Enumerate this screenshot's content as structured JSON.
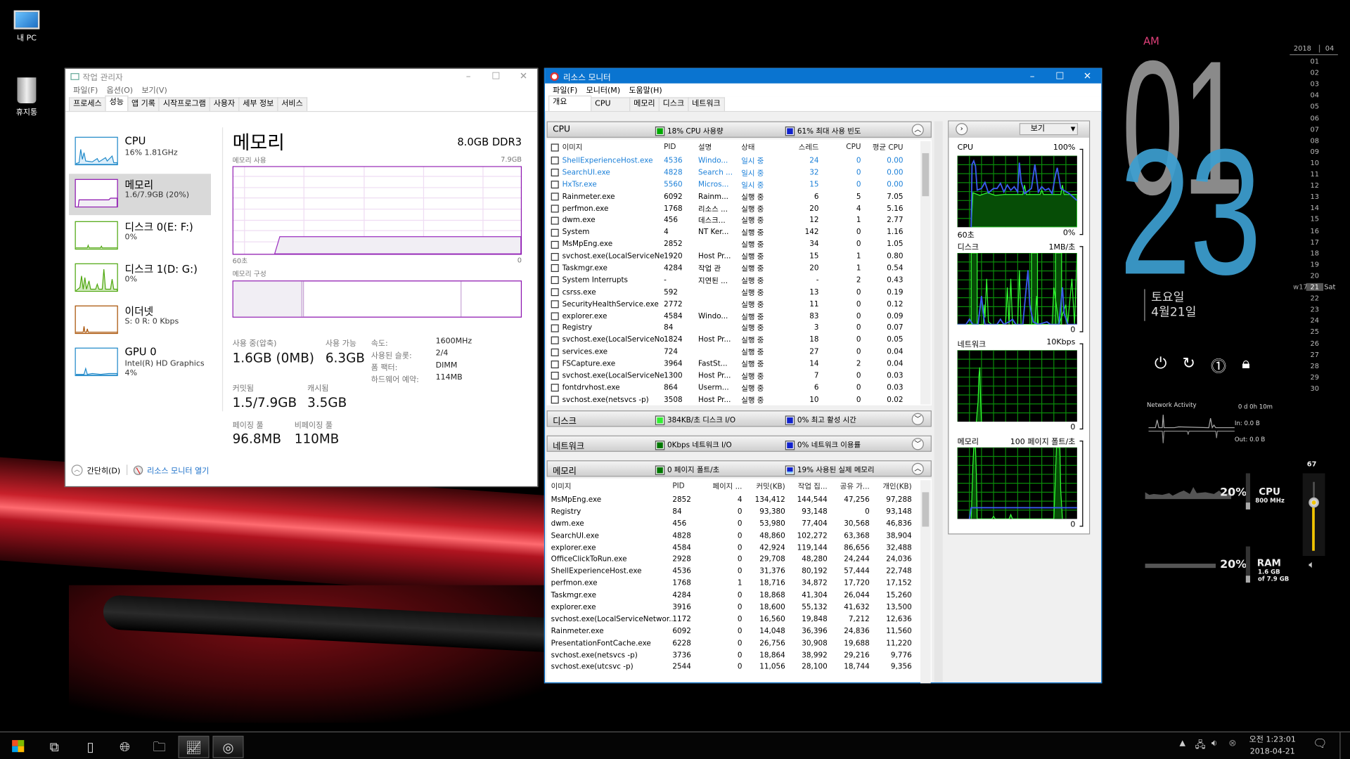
{
  "desktop": {
    "icons": [
      {
        "label": "내 PC",
        "icon": "computer-icon"
      },
      {
        "label": "휴지통",
        "icon": "recycle-bin-icon"
      }
    ]
  },
  "taskmgr": {
    "title": "작업 관리자",
    "menu": [
      "파일(F)",
      "옵션(O)",
      "보기(V)"
    ],
    "tabs": [
      "프로세스",
      "성능",
      "앱 기록",
      "시작프로그램",
      "사용자",
      "세부 정보",
      "서비스"
    ],
    "selected_tab": "성능",
    "sidebar": [
      {
        "title": "CPU",
        "sub": "16% 1.81GHz",
        "color": "#1e88c8"
      },
      {
        "title": "메모리",
        "sub": "1.6/7.9GB (20%)",
        "color": "#8b12ae",
        "selected": true
      },
      {
        "title": "디스크 0(E: F:)",
        "sub": "0%",
        "color": "#4da60c"
      },
      {
        "title": "디스크 1(D: G:)",
        "sub": "0%",
        "color": "#4da60c"
      },
      {
        "title": "이더넷",
        "sub": "S: 0 R: 0 Kbps",
        "color": "#a74f01"
      },
      {
        "title": "GPU 0",
        "sub": "Intel(R) HD Graphics",
        "sub2": "4%",
        "color": "#1e88c8"
      }
    ],
    "main": {
      "title": "메모리",
      "spec": "8.0GB DDR3",
      "usage_label": "메모리 사용",
      "usage_max": "7.9GB",
      "time_left": "60초",
      "time_right": "0",
      "composition_label": "메모리 구성",
      "in_use_label": "사용 중(압축)",
      "in_use": "1.6GB (0MB)",
      "available_label": "사용 가능",
      "available": "6.3GB",
      "committed_label": "커밋됨",
      "committed": "1.5/7.9GB",
      "cached_label": "캐시됨",
      "cached": "3.5GB",
      "paged_label": "페이징 풀",
      "paged": "96.8MB",
      "nonpaged_label": "비페이징 풀",
      "nonpaged": "110MB",
      "speed_label": "속도:",
      "speed": "1600MHz",
      "slots_label": "사용된 슬롯:",
      "slots": "2/4",
      "form_label": "폼 팩터:",
      "form": "DIMM",
      "hwres_label": "하드웨어 예약:",
      "hwres": "114MB",
      "usage_percent": 20
    },
    "footer": {
      "less": "간단히(D)",
      "open_resmon": "리소스 모니터 열기"
    }
  },
  "resmon": {
    "title": "리소스 모니터",
    "menu": [
      "파일(F)",
      "모니터(M)",
      "도움말(H)"
    ],
    "tabs": [
      "개요",
      "CPU",
      "메모리",
      "디스크",
      "네트워크"
    ],
    "cpu": {
      "name": "CPU",
      "stat1": "18% CPU 사용량",
      "stat2": "61% 최대 사용 빈도",
      "headers": [
        "이미지",
        "PID",
        "설명",
        "상태",
        "스레드",
        "CPU",
        "평균 CPU"
      ],
      "rows": [
        {
          "n": "ShellExperienceHost.exe",
          "p": "4536",
          "d": "Windo...",
          "s": "일시 중",
          "t": "24",
          "c": "0",
          "a": "0.00",
          "susp": true
        },
        {
          "n": "SearchUI.exe",
          "p": "4828",
          "d": "Search ...",
          "s": "일시 중",
          "t": "32",
          "c": "0",
          "a": "0.00",
          "susp": true
        },
        {
          "n": "HxTsr.exe",
          "p": "5560",
          "d": "Micros...",
          "s": "일시 중",
          "t": "15",
          "c": "0",
          "a": "0.00",
          "susp": true
        },
        {
          "n": "Rainmeter.exe",
          "p": "6092",
          "d": "Rainm...",
          "s": "실행 중",
          "t": "6",
          "c": "5",
          "a": "7.05"
        },
        {
          "n": "perfmon.exe",
          "p": "1768",
          "d": "리소스 ...",
          "s": "실행 중",
          "t": "20",
          "c": "4",
          "a": "5.16"
        },
        {
          "n": "dwm.exe",
          "p": "456",
          "d": "데스크...",
          "s": "실행 중",
          "t": "12",
          "c": "1",
          "a": "2.77"
        },
        {
          "n": "System",
          "p": "4",
          "d": "NT Ker...",
          "s": "실행 중",
          "t": "142",
          "c": "0",
          "a": "1.16"
        },
        {
          "n": "MsMpEng.exe",
          "p": "2852",
          "d": "",
          "s": "실행 중",
          "t": "34",
          "c": "0",
          "a": "1.05"
        },
        {
          "n": "svchost.exe(LocalServiceNet...",
          "p": "1920",
          "d": "Host Pr...",
          "s": "실행 중",
          "t": "15",
          "c": "1",
          "a": "0.80"
        },
        {
          "n": "Taskmgr.exe",
          "p": "4284",
          "d": "작업 관",
          "s": "실행 중",
          "t": "20",
          "c": "1",
          "a": "0.54"
        },
        {
          "n": "System Interrupts",
          "p": "-",
          "d": "지연된 ...",
          "s": "실행 중",
          "t": "-",
          "c": "2",
          "a": "0.43"
        },
        {
          "n": "csrss.exe",
          "p": "592",
          "d": "",
          "s": "실행 중",
          "t": "13",
          "c": "0",
          "a": "0.19"
        },
        {
          "n": "SecurityHealthService.exe",
          "p": "2772",
          "d": "",
          "s": "실행 중",
          "t": "11",
          "c": "0",
          "a": "0.12"
        },
        {
          "n": "explorer.exe",
          "p": "4584",
          "d": "Windo...",
          "s": "실행 중",
          "t": "83",
          "c": "0",
          "a": "0.09"
        },
        {
          "n": "Registry",
          "p": "84",
          "d": "",
          "s": "실행 중",
          "t": "3",
          "c": "0",
          "a": "0.07"
        },
        {
          "n": "svchost.exe(LocalServiceNoN...",
          "p": "1824",
          "d": "Host Pr...",
          "s": "실행 중",
          "t": "18",
          "c": "0",
          "a": "0.05"
        },
        {
          "n": "services.exe",
          "p": "724",
          "d": "",
          "s": "실행 중",
          "t": "27",
          "c": "0",
          "a": "0.04"
        },
        {
          "n": "FSCapture.exe",
          "p": "3964",
          "d": "FastSt...",
          "s": "실행 중",
          "t": "14",
          "c": "2",
          "a": "0.04"
        },
        {
          "n": "svchost.exe(LocalServiceNet...",
          "p": "1300",
          "d": "Host Pr...",
          "s": "실행 중",
          "t": "7",
          "c": "0",
          "a": "0.03"
        },
        {
          "n": "fontdrvhost.exe",
          "p": "864",
          "d": "Userm...",
          "s": "실행 중",
          "t": "6",
          "c": "0",
          "a": "0.03"
        },
        {
          "n": "svchost.exe(netsvcs -p)",
          "p": "3508",
          "d": "Host Pr...",
          "s": "실행 중",
          "t": "10",
          "c": "0",
          "a": "0.02"
        }
      ]
    },
    "disk": {
      "name": "디스크",
      "stat1": "384KB/초 디스크 I/O",
      "stat2": "0% 최고 활성 시간"
    },
    "network": {
      "name": "네트워크",
      "stat1": "0Kbps 네트워크 I/O",
      "stat2": "0% 네트워크 이용률"
    },
    "memory": {
      "name": "메모리",
      "stat1": "0 페이지 폴트/초",
      "stat2": "19% 사용된 실제 메모리",
      "headers": [
        "이미지",
        "PID",
        "페이지 ...",
        "커밋(KB)",
        "작업 집...",
        "공유 가...",
        "개인(KB)"
      ],
      "rows": [
        {
          "n": "MsMpEng.exe",
          "p": "2852",
          "f": "4",
          "c": "134,412",
          "w": "144,544",
          "s": "47,256",
          "v": "97,288"
        },
        {
          "n": "Registry",
          "p": "84",
          "f": "0",
          "c": "93,380",
          "w": "93,148",
          "s": "0",
          "v": "93,148"
        },
        {
          "n": "dwm.exe",
          "p": "456",
          "f": "0",
          "c": "53,980",
          "w": "77,404",
          "s": "30,568",
          "v": "46,836"
        },
        {
          "n": "SearchUI.exe",
          "p": "4828",
          "f": "0",
          "c": "48,860",
          "w": "102,272",
          "s": "63,368",
          "v": "38,904"
        },
        {
          "n": "explorer.exe",
          "p": "4584",
          "f": "0",
          "c": "42,924",
          "w": "119,144",
          "s": "86,656",
          "v": "32,488"
        },
        {
          "n": "OfficeClickToRun.exe",
          "p": "2928",
          "f": "0",
          "c": "29,708",
          "w": "48,280",
          "s": "24,244",
          "v": "24,036"
        },
        {
          "n": "ShellExperienceHost.exe",
          "p": "4536",
          "f": "0",
          "c": "31,376",
          "w": "80,192",
          "s": "57,444",
          "v": "22,748"
        },
        {
          "n": "perfmon.exe",
          "p": "1768",
          "f": "1",
          "c": "18,716",
          "w": "34,872",
          "s": "17,720",
          "v": "17,152"
        },
        {
          "n": "Taskmgr.exe",
          "p": "4284",
          "f": "0",
          "c": "18,868",
          "w": "41,304",
          "s": "26,044",
          "v": "15,260"
        },
        {
          "n": "explorer.exe",
          "p": "3916",
          "f": "0",
          "c": "18,600",
          "w": "55,132",
          "s": "41,632",
          "v": "13,500"
        },
        {
          "n": "svchost.exe(LocalServiceNetwor...",
          "p": "1172",
          "f": "0",
          "c": "16,560",
          "w": "19,848",
          "s": "7,212",
          "v": "12,636"
        },
        {
          "n": "Rainmeter.exe",
          "p": "6092",
          "f": "0",
          "c": "14,048",
          "w": "36,396",
          "s": "24,836",
          "v": "11,560"
        },
        {
          "n": "PresentationFontCache.exe",
          "p": "6228",
          "f": "0",
          "c": "26,756",
          "w": "30,908",
          "s": "19,688",
          "v": "11,220"
        },
        {
          "n": "svchost.exe(netsvcs -p)",
          "p": "3736",
          "f": "0",
          "c": "18,864",
          "w": "38,992",
          "s": "29,216",
          "v": "9,776"
        },
        {
          "n": "svchost.exe(utcsvc -p)",
          "p": "2544",
          "f": "0",
          "c": "11,056",
          "w": "28,100",
          "s": "18,744",
          "v": "9,356"
        }
      ]
    },
    "side": {
      "view_label": "보기",
      "graphs": [
        {
          "name": "CPU",
          "max": "100%",
          "time": "60초",
          "min": "0%"
        },
        {
          "name": "디스크",
          "max": "1MB/초",
          "min": "0"
        },
        {
          "name": "네트워크",
          "max": "10Kbps",
          "min": "0"
        },
        {
          "name": "메모리",
          "max": "100 페이지 폴트/초",
          "min": "0"
        }
      ]
    }
  },
  "clock": {
    "ampm": "AM",
    "hour": "01",
    "minute": "23",
    "weekday": "토요일",
    "date": "4월21일",
    "calendar": {
      "year": "2018",
      "month": "04",
      "week": "w17",
      "today": "21",
      "today_dow": "Sat",
      "days": [
        "01",
        "02",
        "03",
        "04",
        "05",
        "06",
        "07",
        "08",
        "09",
        "10",
        "11",
        "12",
        "13",
        "14",
        "15",
        "16",
        "17",
        "18",
        "19",
        "20",
        "21",
        "22",
        "23",
        "24",
        "25",
        "26",
        "27",
        "28",
        "29",
        "30"
      ]
    },
    "colors": {
      "hour": "#8a8a8a",
      "minute": "#3d9fd0",
      "ampm": "#e0407a"
    }
  },
  "system": {
    "network_title": "Network Activity",
    "uptime": "0 d 0h 10m",
    "net_in": "In: 0.0 B",
    "net_out": "Out: 0.0 B",
    "cpu_percent": "20%",
    "cpu_label": "CPU",
    "cpu_freq": "800 MHz",
    "ram_percent": "20%",
    "ram_label": "RAM",
    "ram_used": "1.6 GB",
    "ram_total": "of 7.9 GB",
    "volume": "67",
    "volume_level": 67
  },
  "taskbar": {
    "time": "오전 1:23:01",
    "date": "2018-04-21"
  }
}
